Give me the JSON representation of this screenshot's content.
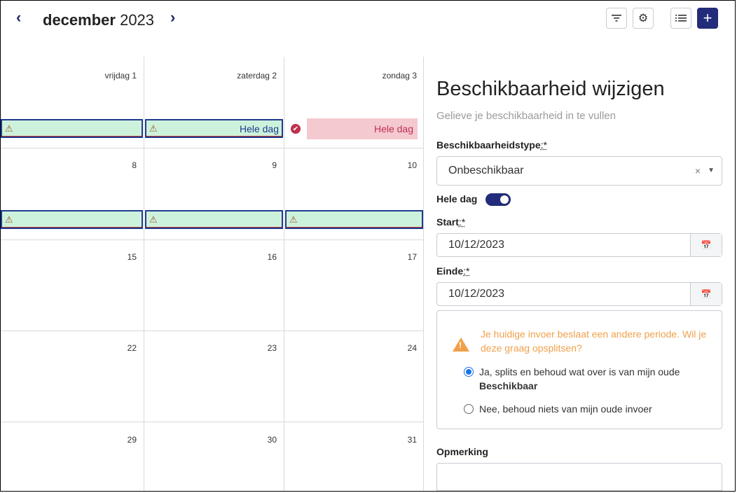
{
  "header": {
    "prev_icon": "chevron-left-icon",
    "next_icon": "chevron-right-icon",
    "month": "december",
    "year": "2023",
    "buttons": [
      "filter-icon",
      "settings-icon",
      "list-icon",
      "plus-icon"
    ]
  },
  "calendar": {
    "day_headers": [
      "vrijdag 1",
      "zaterdag 2",
      "zondag 3"
    ],
    "weeks": [
      [
        "8",
        "9",
        "10"
      ],
      [
        "15",
        "16",
        "17"
      ],
      [
        "22",
        "23",
        "24"
      ],
      [
        "29",
        "30",
        "31"
      ]
    ],
    "event_label": "Hele dag",
    "colors": {
      "available": "#cdf2dc",
      "unavailable": "#f4c9d0",
      "accent": "#232c7a"
    }
  },
  "panel": {
    "title": "Beschikbaarheid wijzigen",
    "subtitle": "Gelieve je beschikbaarheid in te vullen",
    "type_label": "Beschikbaarheidstype",
    "required_mark": ":*",
    "type_value": "Onbeschikbaar",
    "clear": "×",
    "whole_day_label": "Hele dag",
    "whole_day_on": true,
    "start_label": "Start",
    "start_value": "10/12/2023",
    "end_label": "Einde",
    "end_value": "10/12/2023",
    "alert_text": "Je huidige invoer beslaat een andere periode. Wil je deze graag opsplitsen?",
    "option_yes": "Ja, splits en behoud wat over is van mijn oude",
    "option_yes_bold": "Beschikbaar",
    "option_no": "Nee, behoud niets van mijn oude invoer",
    "note_label": "Opmerking"
  }
}
